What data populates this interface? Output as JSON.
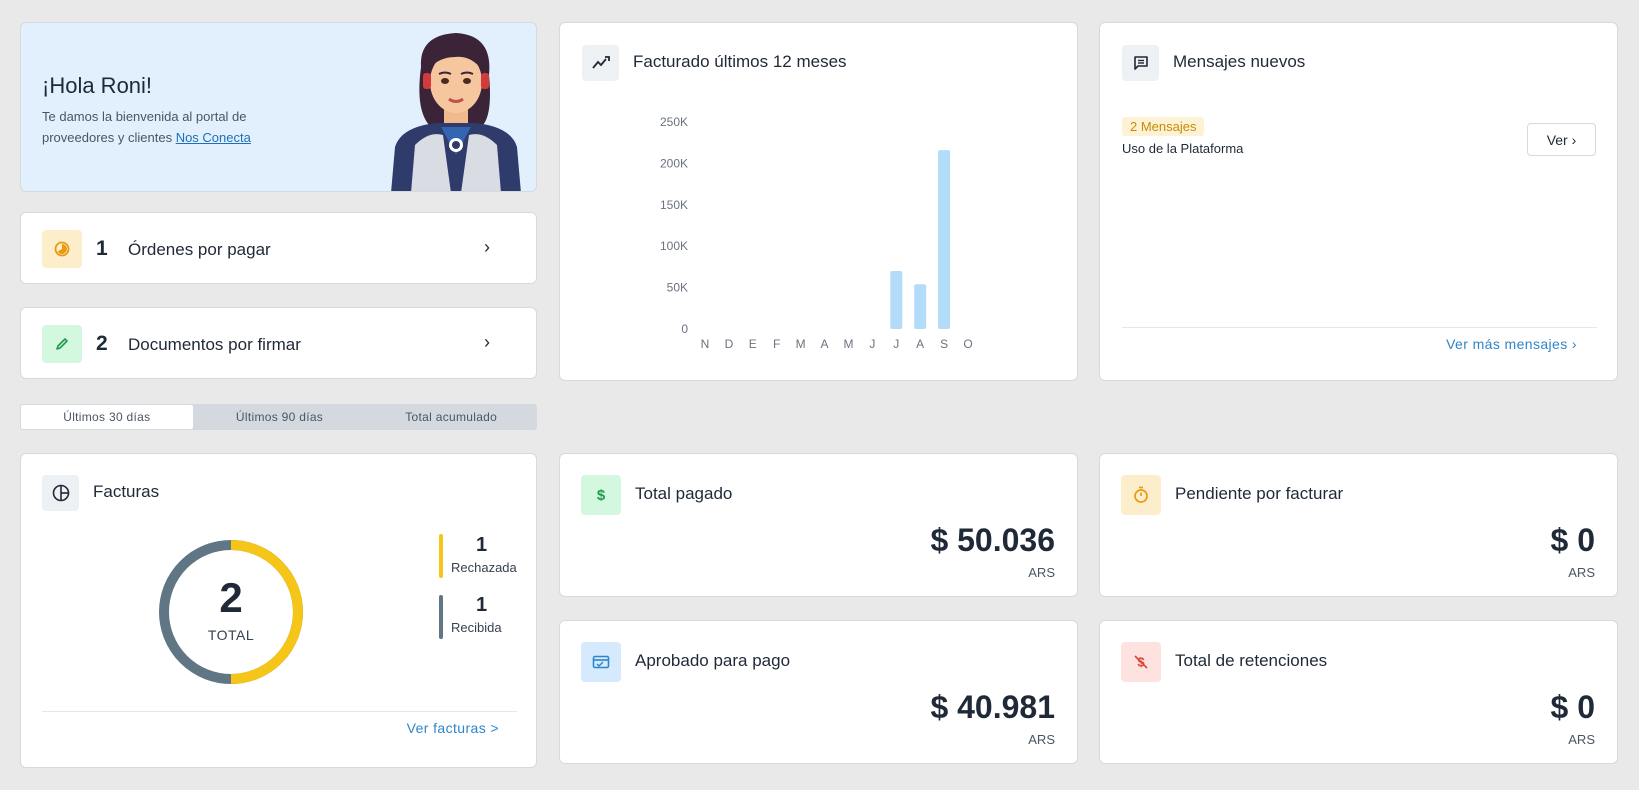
{
  "welcome": {
    "greeting": "¡Hola Roni!",
    "text": "Te damos la bienvenida al portal de proveedores y clientes ",
    "link": "Nos Conecta"
  },
  "actions": [
    {
      "count": "1",
      "label": "Órdenes por pagar",
      "icon": "clock-pie-icon",
      "color": "#fdeecb"
    },
    {
      "count": "2",
      "label": "Documentos por firmar",
      "icon": "pencil-icon",
      "color": "#d4f7df"
    }
  ],
  "tabs": [
    "Últimos 30 días",
    "Últimos 90 días",
    "Total acumulado"
  ],
  "chart_card": {
    "title": "Facturado últimos 12 meses",
    "icon": "trend-icon"
  },
  "chart_data": {
    "type": "bar",
    "categories": [
      "N",
      "D",
      "E",
      "F",
      "M",
      "A",
      "M",
      "J",
      "J",
      "A",
      "S",
      "O"
    ],
    "values": [
      0,
      0,
      0,
      0,
      0,
      0,
      0,
      0,
      70000,
      54000,
      216000,
      0
    ],
    "ytick_labels": [
      "0",
      "50K",
      "100K",
      "150K",
      "200K",
      "250K"
    ],
    "ytick_values": [
      0,
      50000,
      100000,
      150000,
      200000,
      250000
    ],
    "ylim": [
      0,
      250000
    ],
    "bar_color": "#b3dcfb",
    "grid": false
  },
  "messages": {
    "title": "Mensajes nuevos",
    "icon": "chat-icon",
    "badge": "2 Mensajes",
    "subject": "Uso de la Plataforma",
    "button": "Ver",
    "more": "Ver más mensajes"
  },
  "facturas": {
    "title": "Facturas",
    "icon": "pie-chart-icon",
    "total": "2",
    "total_label": "TOTAL",
    "legend": [
      {
        "count": "1",
        "label": "Rechazada",
        "color": "#f5c518",
        "value": 1
      },
      {
        "count": "1",
        "label": "Recibida",
        "color": "#607684",
        "value": 1
      }
    ],
    "link": "Ver facturas >"
  },
  "stats": {
    "pagado": {
      "title": "Total pagado",
      "amount": "$ 50.036",
      "currency": "ARS",
      "icon": "dollar-icon",
      "color": "#d4f7df"
    },
    "pendiente": {
      "title": "Pendiente por facturar",
      "amount": "$ 0",
      "currency": "ARS",
      "icon": "stopwatch-icon",
      "color": "#fdeecb"
    },
    "aprobado": {
      "title": "Aprobado para pago",
      "amount": "$ 40.981",
      "currency": "ARS",
      "icon": "card-icon",
      "color": "#d5eafd"
    },
    "retenciones": {
      "title": "Total de retenciones",
      "amount": "$ 0",
      "currency": "ARS",
      "icon": "no-dollar-icon",
      "color": "#fde2df"
    }
  }
}
